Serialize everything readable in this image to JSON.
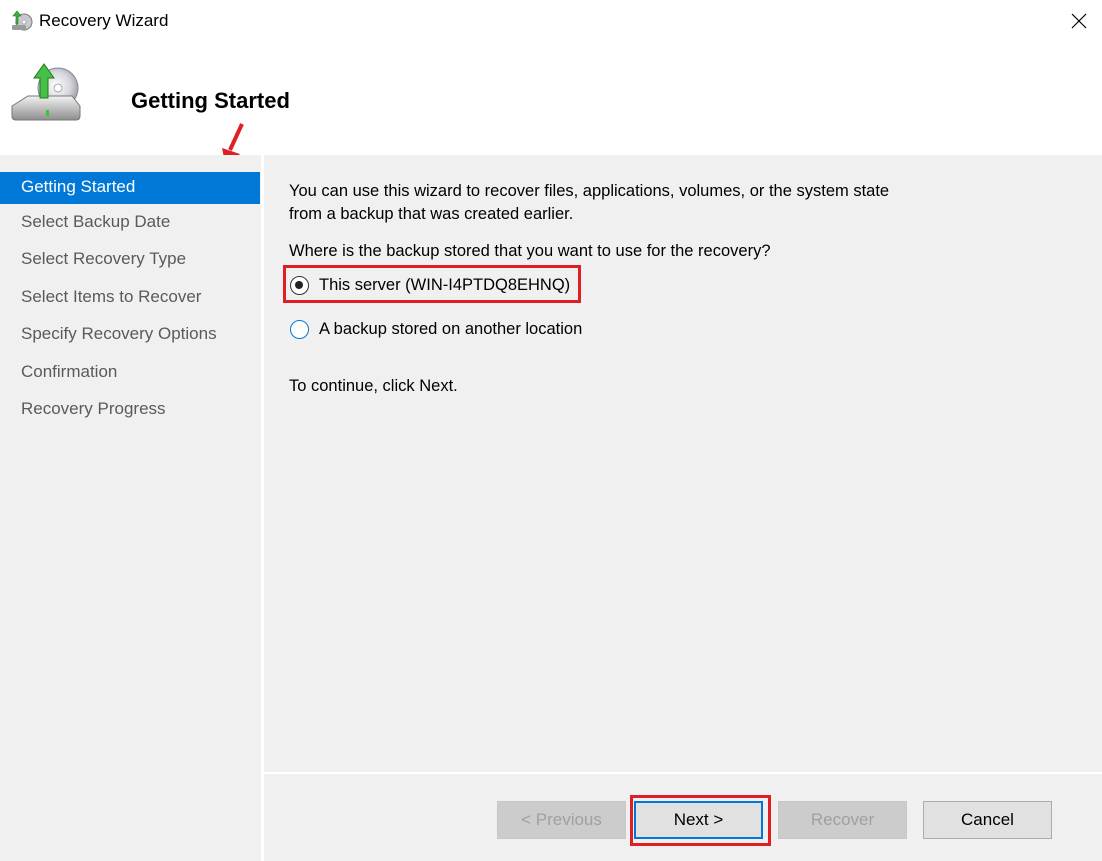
{
  "window": {
    "title": "Recovery Wizard",
    "icon": "recovery-wizard-icon",
    "close_icon": "close-icon"
  },
  "header": {
    "title": "Getting Started",
    "icon": "backup-drive-restore-icon"
  },
  "nav": {
    "items": [
      {
        "label": "Getting Started",
        "active": true
      },
      {
        "label": "Select Backup Date",
        "active": false
      },
      {
        "label": "Select Recovery Type",
        "active": false
      },
      {
        "label": "Select Items to Recover",
        "active": false
      },
      {
        "label": "Specify Recovery Options",
        "active": false
      },
      {
        "label": "Confirmation",
        "active": false
      },
      {
        "label": "Recovery Progress",
        "active": false
      }
    ]
  },
  "content": {
    "intro_line1": "You can use this wizard to recover files, applications, volumes, or the system state",
    "intro_line2": "from a backup that was created earlier.",
    "question": "Where is the backup stored that you want to use for the recovery?",
    "options": [
      {
        "label": "This server (WIN-I4PTDQ8EHNQ)",
        "checked": true
      },
      {
        "label": "A backup stored on another location",
        "checked": false
      }
    ],
    "continue_text": "To continue, click Next."
  },
  "buttons": {
    "previous": {
      "label": "< Previous",
      "enabled": false
    },
    "next": {
      "label": "Next >",
      "enabled": true
    },
    "recover": {
      "label": "Recover",
      "enabled": false
    },
    "cancel": {
      "label": "Cancel",
      "enabled": true
    }
  },
  "colors": {
    "accent": "#0078d7",
    "annotation": "#e01e24",
    "panel_bg": "#f0f0f0"
  }
}
